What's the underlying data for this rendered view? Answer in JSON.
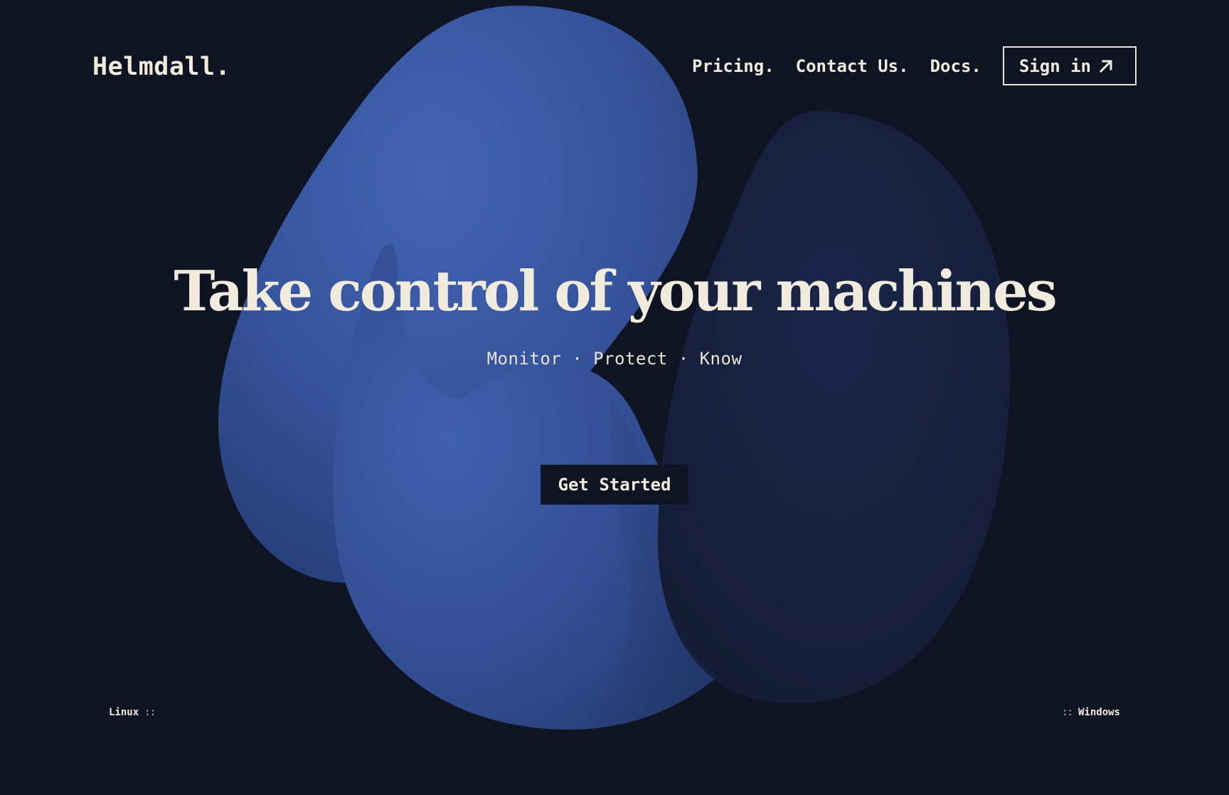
{
  "brand": {
    "name": "Helmdall.",
    "text_color": "#f1ebdd",
    "background_color": "#0f1422",
    "blob_blue": "#3e5ea8",
    "blob_dark": "#172240"
  },
  "nav": {
    "links": [
      {
        "label": "Pricing."
      },
      {
        "label": "Contact Us."
      },
      {
        "label": "Docs."
      }
    ],
    "sign_in_label": "Sign in",
    "sign_in_icon": "arrow-up-right-icon"
  },
  "hero": {
    "title": "Take control of your machines",
    "tagline": "Monitor · Protect · Know",
    "cta_label": "Get Started"
  },
  "footer": {
    "left_label": "Linux",
    "left_glyph": "::",
    "right_label": "Windows",
    "right_glyph": "::"
  }
}
